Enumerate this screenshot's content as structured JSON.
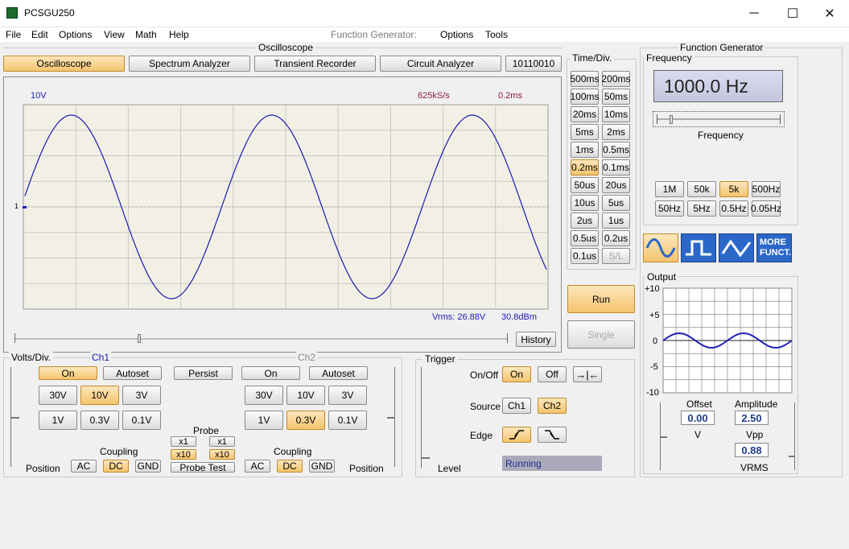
{
  "window": {
    "title": "PCSGU250",
    "min": "─",
    "max": "☐",
    "close": "✕"
  },
  "menu": [
    "File",
    "Edit",
    "Options",
    "View",
    "Math",
    "Help"
  ],
  "menu_right": {
    "fg_label": "Function Generator:",
    "options": "Options",
    "tools": "Tools"
  },
  "osc_group": "Oscilloscope",
  "tabs": [
    "Oscilloscope",
    "Spectrum Analyzer",
    "Transient Recorder",
    "Circuit Analyzer",
    "10110010"
  ],
  "scope": {
    "volts_label": "10V",
    "rate_label": "625kS/s",
    "time_label": "0.2ms",
    "ch_marker": "1",
    "vrms": "Vrms: 26.88V",
    "dbm": "30.8dBm",
    "history": "History"
  },
  "time_div": {
    "title": "Time/Div.",
    "buttons": [
      "500ms",
      "200ms",
      "100ms",
      "50ms",
      "20ms",
      "10ms",
      "5ms",
      "2ms",
      "1ms",
      "0.5ms",
      "0.2ms",
      "0.1ms",
      "50us",
      "20us",
      "10us",
      "5us",
      "2us",
      "1us",
      "0.5us",
      "0.2us",
      "0.1us",
      "S/L"
    ],
    "selected": "0.2ms",
    "run": "Run",
    "single": "Single"
  },
  "fg": {
    "group": "Function Generator",
    "freq_group": "Frequency",
    "freq_display": "1000.0 Hz",
    "freq_label": "Frequency",
    "range_row1": [
      "1M",
      "50k",
      "5k",
      "500Hz"
    ],
    "range_row2": [
      "50Hz",
      "5Hz",
      "0.5Hz",
      "0.05Hz"
    ],
    "selected_range": "5k",
    "more": "MORE FUNCT.",
    "output": "Output",
    "y_ticks": [
      "+10",
      "+5",
      "0",
      "-5",
      "-10"
    ],
    "offset_label": "Offset",
    "offset_val": "0.00",
    "offset_unit": "V",
    "amp_label": "Amplitude",
    "amp_val": "2.50",
    "amp_unit": "Vpp",
    "vrms_val": "0.88",
    "vrms_unit": "VRMS"
  },
  "volts_div": {
    "title": "Volts/Div.",
    "ch1": "Ch1",
    "ch2": "Ch2",
    "on": "On",
    "autoset": "Autoset",
    "persist": "Persist",
    "row1": [
      "30V",
      "10V",
      "3V"
    ],
    "row2": [
      "1V",
      "0.3V",
      "0.1V"
    ],
    "ch1_sel": "10V",
    "ch2_sel": "0.3V",
    "probe": "Probe",
    "x1": "x1",
    "x10": "x10",
    "probe_test": "Probe Test",
    "coupling": "Coupling",
    "ac": "AC",
    "dc": "DC",
    "gnd": "GND",
    "position": "Position"
  },
  "trigger": {
    "title": "Trigger",
    "onoff": "On/Off",
    "on": "On",
    "off": "Off",
    "source": "Source",
    "ch1": "Ch1",
    "ch2": "Ch2",
    "edge": "Edge",
    "level": "Level",
    "status": "Running"
  },
  "colors": {
    "accent": "#f4c46e",
    "trace": "#1a1ab0",
    "screen": "#f2f0e4"
  },
  "chart_data": {
    "type": "line",
    "xlabel": "",
    "ylabel": "",
    "series": [
      {
        "waveform": "sine",
        "cycles_shown": 2.6
      }
    ],
    "grid": true
  }
}
